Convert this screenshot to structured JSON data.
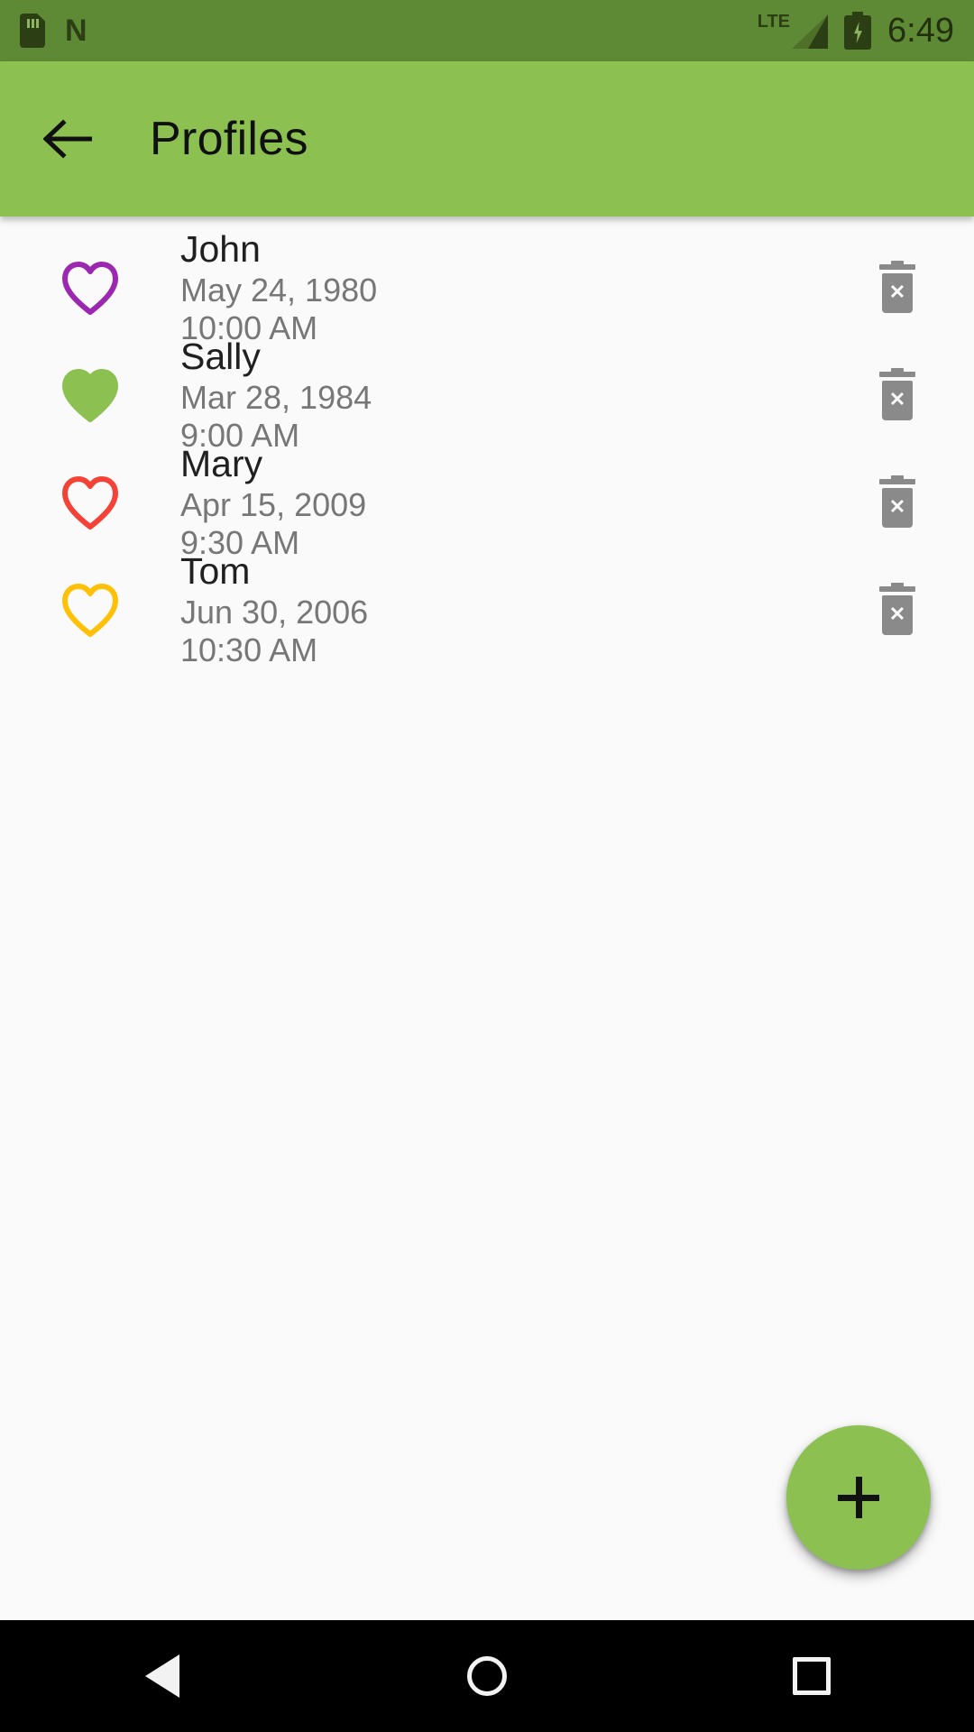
{
  "status_bar": {
    "background_color": "#5f8a35",
    "sd_card_icon": "sd-card-icon",
    "android_n_icon": "android-n-logo",
    "network_type": "LTE",
    "signal_icon": "signal-bars-icon",
    "battery_icon": "battery-charging-icon",
    "clock": "6:49"
  },
  "app_bar": {
    "background_color": "#8cc152",
    "back_icon": "back-arrow-icon",
    "title": "Profiles"
  },
  "list": {
    "delete_icon": "trash-icon",
    "items": [
      {
        "name": "John",
        "date": "May 24, 1980",
        "time": "10:00 AM",
        "heart_color": "#9c27b0",
        "heart_filled": false,
        "heart_icon": "heart-outline-icon"
      },
      {
        "name": "Sally",
        "date": "Mar 28, 1984",
        "time": "9:00 AM",
        "heart_color": "#8cc152",
        "heart_filled": true,
        "heart_icon": "heart-filled-icon"
      },
      {
        "name": "Mary",
        "date": "Apr 15, 2009",
        "time": "9:30 AM",
        "heart_color": "#f44336",
        "heart_filled": false,
        "heart_icon": "heart-outline-icon"
      },
      {
        "name": "Tom",
        "date": "Jun 30, 2006",
        "time": "10:30 AM",
        "heart_color": "#ffc107",
        "heart_filled": false,
        "heart_icon": "heart-outline-icon"
      }
    ]
  },
  "fab": {
    "label": "+",
    "icon": "plus-icon",
    "background_color": "#8cc152"
  },
  "nav_bar": {
    "background_color": "#000000",
    "back_icon": "nav-back-triangle-icon",
    "home_icon": "nav-home-circle-icon",
    "recents_icon": "nav-recents-square-icon"
  }
}
